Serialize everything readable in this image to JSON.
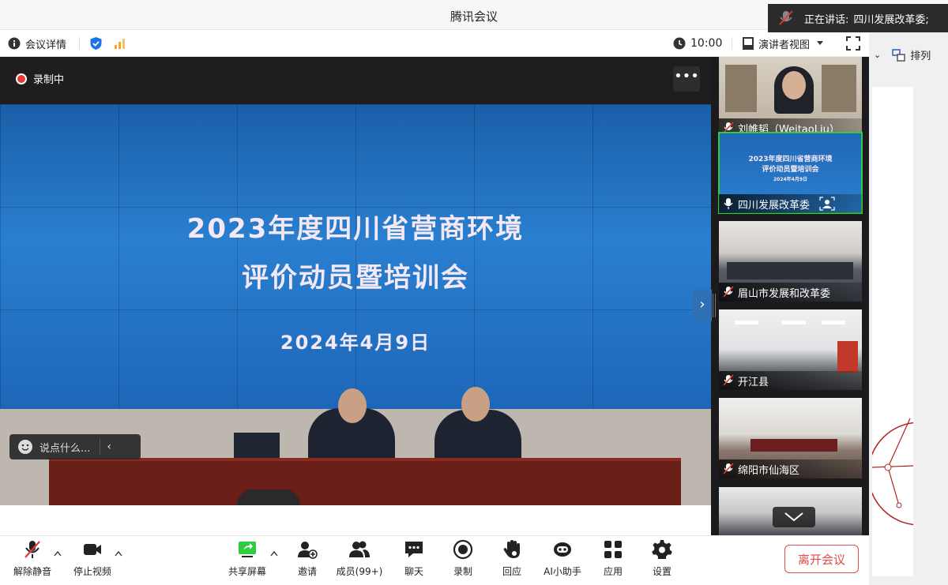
{
  "window": {
    "title": "腾讯会议"
  },
  "speaking_toast": {
    "prefix": "正在讲话:",
    "name": "四川发展改革委;"
  },
  "infobar": {
    "meeting_details": "会议详情",
    "time": "10:00",
    "view_mode": "演讲者视图"
  },
  "background_app": {
    "sort_label": "排列"
  },
  "main": {
    "recording": "录制中",
    "more": "•••",
    "slide": {
      "line1": "2023年度四川省营商环境",
      "line2": "评价动员暨培训会",
      "date": "2024年4月9日"
    },
    "chat_placeholder": "说点什么..."
  },
  "participants": [
    {
      "name": "刘帷韬（WeitaoLiu）",
      "muted": true
    },
    {
      "name": "四川发展改革委",
      "muted": false,
      "active": true
    },
    {
      "name": "眉山市发展和改革委",
      "muted": true
    },
    {
      "name": "开江县",
      "muted": true
    },
    {
      "name": "绵阳市仙海区",
      "muted": true
    }
  ],
  "toolbar": {
    "unmute": "解除静音",
    "stop_video": "停止视频",
    "share_screen": "共享屏幕",
    "invite": "邀请",
    "members": "成员(99+)",
    "chat": "聊天",
    "record": "录制",
    "reaction": "回应",
    "ai_assistant": "AI小助手",
    "apps": "应用",
    "settings": "设置",
    "leave": "离开会议"
  },
  "colors": {
    "accent_green": "#2ecc40",
    "record_red": "#e53935",
    "leave_red": "#e34a4a",
    "slide_blue": "#2a7fd0",
    "shield_blue": "#1a73e8"
  }
}
